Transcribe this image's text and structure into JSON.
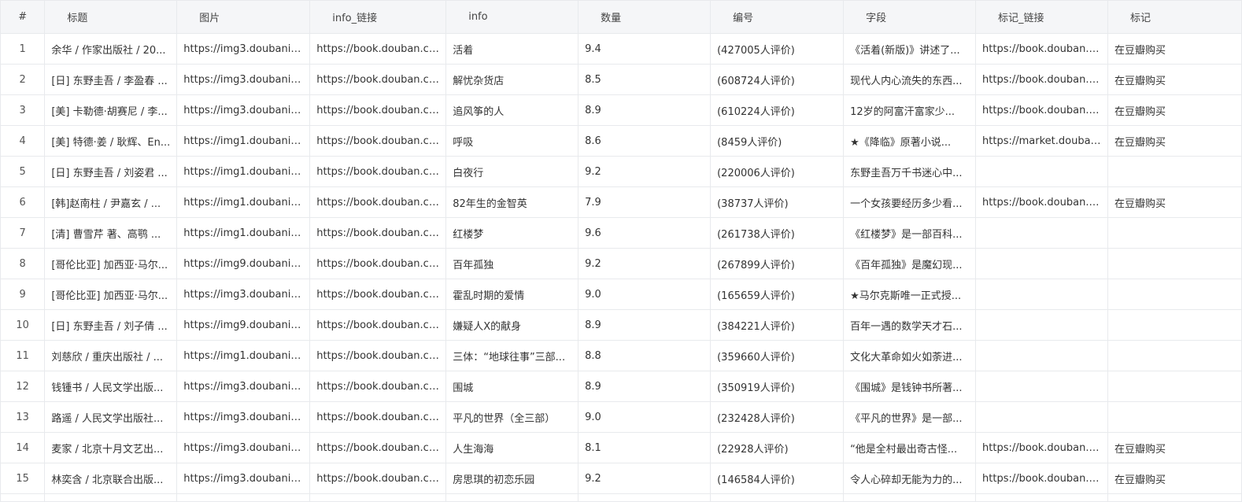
{
  "columns": [
    "#",
    "标题",
    "图片",
    "info_链接",
    "info",
    "数量",
    "编号",
    "字段",
    "标记_链接",
    "标记"
  ],
  "rows": [
    [
      "1",
      "余华 / 作家出版社 / 20...",
      "https://img3.doubanio...",
      "https://book.douban.co...",
      "活着",
      "9.4",
      "(427005人评价)",
      "《活着(新版)》讲述了...",
      "https://book.douban.c...",
      "在豆瓣购买"
    ],
    [
      "2",
      "[日] 东野圭吾 / 李盈春 ...",
      "https://img3.doubanio...",
      "https://book.douban.co...",
      "解忧杂货店",
      "8.5",
      "(608724人评价)",
      "现代人内心流失的东西...",
      "https://book.douban.c...",
      "在豆瓣购买"
    ],
    [
      "3",
      "[美] 卡勒德·胡赛尼 / 李...",
      "https://img3.doubanio...",
      "https://book.douban.co...",
      "追风筝的人",
      "8.9",
      "(610224人评价)",
      "12岁的阿富汗富家少...",
      "https://book.douban.c...",
      "在豆瓣购买"
    ],
    [
      "4",
      "[美] 特德·姜 / 耿辉、En...",
      "https://img1.doubanio...",
      "https://book.douban.co...",
      "呼吸",
      "8.6",
      "(8459人评价)",
      "★《降临》原著小说...",
      "https://market.douban...",
      "在豆瓣购买"
    ],
    [
      "5",
      "[日] 东野圭吾 / 刘姿君 ...",
      "https://img1.doubanio...",
      "https://book.douban.co...",
      "白夜行",
      "9.2",
      "(220006人评价)",
      "东野圭吾万千书迷心中...",
      "",
      ""
    ],
    [
      "6",
      "[韩]赵南柱 / 尹嘉玄 / ...",
      "https://img1.doubanio...",
      "https://book.douban.co...",
      "82年生的金智英",
      "7.9",
      "(38737人评价)",
      "一个女孩要经历多少看...",
      "https://book.douban.c...",
      "在豆瓣购买"
    ],
    [
      "7",
      "[清] 曹雪芹 著、高鹗 ...",
      "https://img1.doubanio...",
      "https://book.douban.co...",
      "红楼梦",
      "9.6",
      "(261738人评价)",
      "《红楼梦》是一部百科...",
      "",
      ""
    ],
    [
      "8",
      "[哥伦比亚] 加西亚·马尔...",
      "https://img9.doubanio...",
      "https://book.douban.co...",
      "百年孤独",
      "9.2",
      "(267899人评价)",
      "《百年孤独》是魔幻现...",
      "",
      ""
    ],
    [
      "9",
      "[哥伦比亚] 加西亚·马尔...",
      "https://img3.doubanio...",
      "https://book.douban.co...",
      "霍乱时期的爱情",
      "9.0",
      "(165659人评价)",
      "★马尔克斯唯一正式授...",
      "",
      ""
    ],
    [
      "10",
      "[日] 东野圭吾 / 刘子倩 ...",
      "https://img9.doubanio...",
      "https://book.douban.co...",
      "嫌疑人X的献身",
      "8.9",
      "(384221人评价)",
      "百年一遇的数学天才石...",
      "",
      ""
    ],
    [
      "11",
      "刘慈欣 / 重庆出版社 / ...",
      "https://img1.doubanio...",
      "https://book.douban.co...",
      "三体：“地球往事”三部...",
      "8.8",
      "(359660人评价)",
      "文化大革命如火如荼进...",
      "",
      ""
    ],
    [
      "12",
      "钱锺书 / 人民文学出版...",
      "https://img3.doubanio...",
      "https://book.douban.co...",
      "围城",
      "8.9",
      "(350919人评价)",
      "《围城》是钱钟书所著...",
      "",
      ""
    ],
    [
      "13",
      "路遥 / 人民文学出版社...",
      "https://img3.doubanio...",
      "https://book.douban.co...",
      "平凡的世界（全三部）",
      "9.0",
      "(232428人评价)",
      "《平凡的世界》是一部...",
      "",
      ""
    ],
    [
      "14",
      "麦家 / 北京十月文艺出...",
      "https://img3.doubanio...",
      "https://book.douban.co...",
      "人生海海",
      "8.1",
      "(22928人评价)",
      "“他是全村最出奇古怪...",
      "https://book.douban.c...",
      "在豆瓣购买"
    ],
    [
      "15",
      "林奕含 / 北京联合出版...",
      "https://img3.doubanio...",
      "https://book.douban.co...",
      "房思琪的初恋乐园",
      "9.2",
      "(146584人评价)",
      "令人心碎却无能为力的...",
      "https://book.douban.c...",
      "在豆瓣购买"
    ]
  ]
}
